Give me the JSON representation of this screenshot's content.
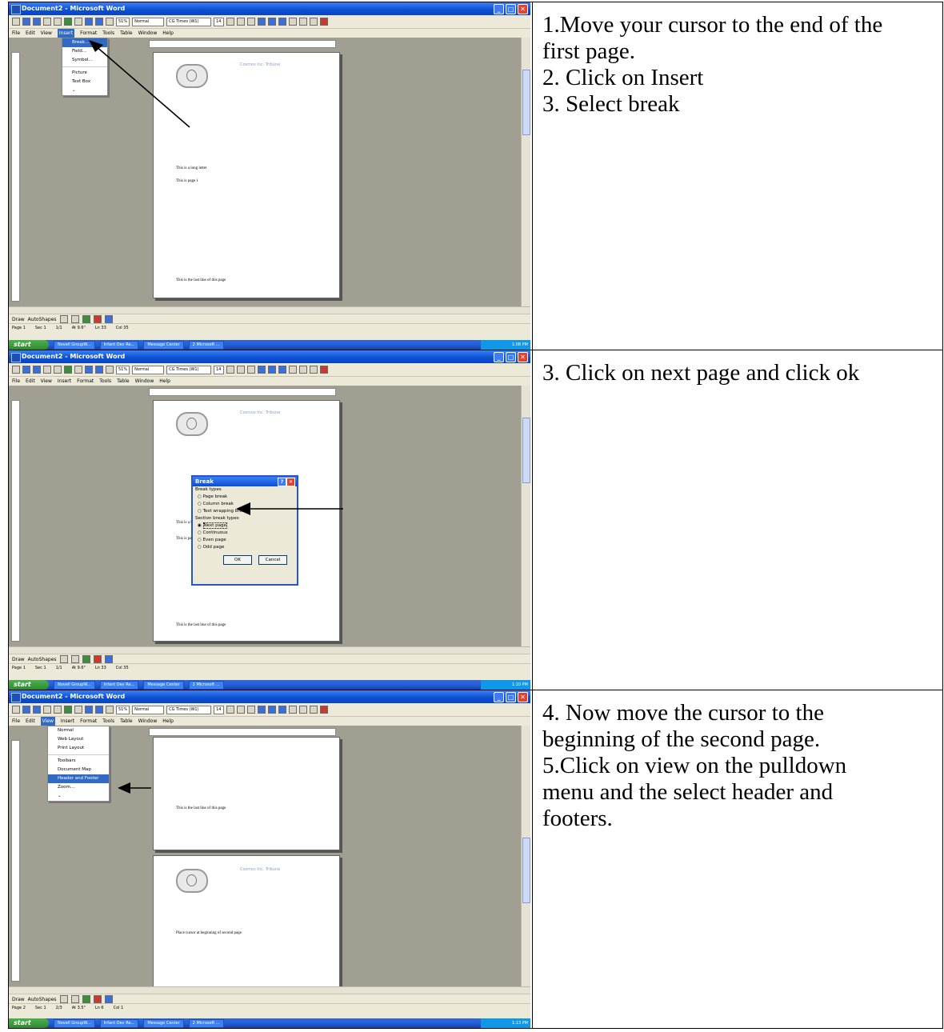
{
  "instructions": [
    {
      "lines": [
        "1.Move your cursor to the end of the",
        "first page.",
        "2. Click on Insert",
        "3. Select break"
      ]
    },
    {
      "lines": [
        "3. Click on next page and click ok"
      ]
    },
    {
      "lines": [
        "4. Now move the cursor to the",
        "beginning of the second page.",
        "5.Click on view on the pulldown",
        "menu and the select header and",
        "footers."
      ]
    }
  ],
  "word": {
    "window_title": "Document2 - Microsoft Word",
    "menu_items": [
      "File",
      "Edit",
      "View",
      "Insert",
      "Format",
      "Tools",
      "Table",
      "Window",
      "Help"
    ],
    "style_box": "Normal",
    "font_box": "CG Times (W1)",
    "size_box": "14",
    "zoom_box": "51%",
    "draw_label": "Draw",
    "autoshapes_label": "AutoShapes",
    "start_label": "start",
    "letterhead": "Cosmos Inc. Tribune",
    "taskbar_items": [
      "Novell GroupW...",
      "Infant Dev Re...",
      "Message Center",
      "2 Microsoft ..."
    ]
  },
  "screen1": {
    "insert_menu": [
      "Break...",
      "Field...",
      "Symbol...",
      "Picture",
      "Text Box"
    ],
    "doc_lines": [
      "This is a long letter",
      "This is page 1",
      "This is the last line of this page"
    ],
    "status": [
      "Page 1",
      "Sec 1",
      "1/1",
      "At 9.6\"",
      "Ln 33",
      "Col 35"
    ],
    "clock": "1:08 PM"
  },
  "screen2": {
    "dialog_title": "Break",
    "group1": "Break types",
    "opts1": [
      "Page break",
      "Column break",
      "Text wrapping break"
    ],
    "group2": "Section break types",
    "opts2": [
      "Next page",
      "Continuous",
      "Even page",
      "Odd page"
    ],
    "ok": "OK",
    "cancel": "Cancel",
    "doc_lines": [
      "This is a l",
      "This is pag",
      "This is the last line of this page"
    ],
    "status": [
      "Page 1",
      "Sec 1",
      "1/1",
      "At 9.6\"",
      "Ln 33",
      "Col 35"
    ],
    "clock": "1:10 PM"
  },
  "screen3": {
    "view_menu": [
      "Normal",
      "Web Layout",
      "Print Layout",
      "Toolbars",
      "Document Map",
      "Header and Footer",
      "Zoom..."
    ],
    "doc_lines": [
      "This is the last line of this page",
      "Place cursor at beginning of second page"
    ],
    "status": [
      "Page 2",
      "Sec 1",
      "2/3",
      "At 3.5\"",
      "Ln 6",
      "Col 1"
    ],
    "clock": "1:13 PM"
  }
}
